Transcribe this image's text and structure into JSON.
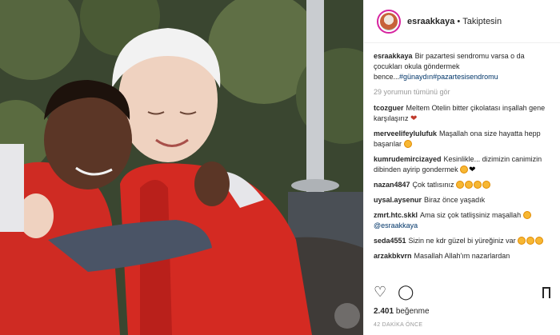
{
  "post": {
    "username": "esraakkaya",
    "follow_status": "Takiptesin",
    "caption_user": "esraakkaya",
    "caption_text": "Bir pazartesi sendromu varsa o da çocukları okula göndermek bence...",
    "caption_tags": "#günaydın#pazartesisendromu",
    "see_all_comments": "29 yorumun tümünü gör",
    "likes_count": "2.401",
    "likes_label": "beğenme",
    "time_ago": "42 DAKİKA ÖNCE"
  },
  "comments": [
    {
      "user": "tcozguer",
      "text": "Meltem Otelin bitter çikolatası inşallah gene karşılaşırız"
    },
    {
      "user": "merveelifeylulufuk",
      "text": "Maşallah ona size hayatta hepp başarılar"
    },
    {
      "user": "kumrudemircizayed",
      "text": "Kesinlikle... dizimizin canimizin dibinden ayirip gondermek"
    },
    {
      "user": "nazan4847",
      "text": "Çok tatlısınız"
    },
    {
      "user": "uysal.aysenur",
      "text": "Biraz önce yaşadık"
    },
    {
      "user": "zmrt.htc.skkl",
      "text": "Ama siz çok tatlişsiniz maşallah",
      "mention": "@esraakkaya"
    },
    {
      "user": "seda4551",
      "text": "Sizin ne kdr güzel bi yüreğiniz var"
    },
    {
      "user": "arzakbkvrn",
      "text": "Masallah Allah'ım nazarlardan"
    }
  ],
  "icons": {
    "like": "heart-outline-icon",
    "comment": "comment-bubble-icon",
    "save": "bookmark-icon"
  },
  "colors": {
    "mention": "#003569",
    "muted": "#999999",
    "jacket": "#d42a22"
  }
}
